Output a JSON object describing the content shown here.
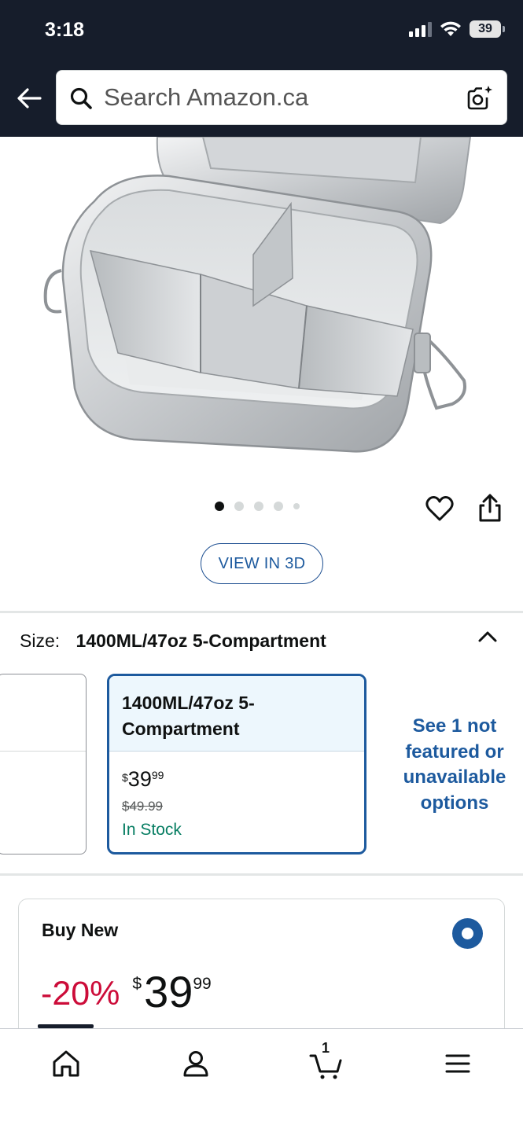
{
  "status_bar": {
    "time": "3:18",
    "battery": "39"
  },
  "search": {
    "placeholder": "Search Amazon.ca"
  },
  "gallery": {
    "image_count": 5,
    "active_index": 0
  },
  "view3d": {
    "label": "VIEW IN 3D"
  },
  "size": {
    "label": "Size:",
    "selected": "1400ML/47oz 5-Compartment",
    "option": {
      "name": "1400ML/47oz 5-Compartment",
      "currency": "$",
      "price_whole": "39",
      "price_fraction": "99",
      "list_price": "$49.99",
      "availability": "In Stock"
    },
    "see_more": "See 1 not featured or unavailable options"
  },
  "buy_new": {
    "title": "Buy New",
    "discount": "-20%",
    "currency": "$",
    "price_whole": "39",
    "price_fraction": "99"
  },
  "bottom_nav": {
    "items": [
      "home-icon",
      "account-icon",
      "cart-icon",
      "menu-icon"
    ],
    "cart_count": "1"
  },
  "colors": {
    "header_bg": "#161d2b",
    "link_blue": "#1d5a9e",
    "discount_red": "#cc0c39",
    "stock_green": "#067d62"
  }
}
